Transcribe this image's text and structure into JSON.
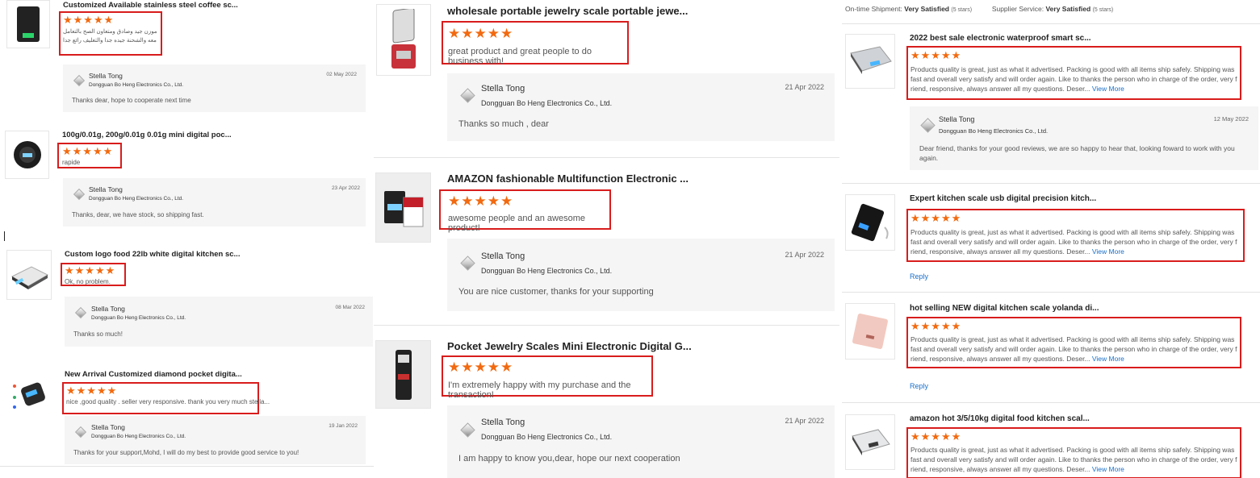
{
  "col1": {
    "reviews": [
      {
        "title": "Customized Available stainless steel coffee sc...",
        "stars": "★★★★★",
        "text": "موزن جيد وصادق ومتعاون الصح بالتعامل معه والشحنة جيده جدا والتغليف رائع جدا",
        "reply_name": "Stella Tong",
        "reply_company": "Dongguan Bo Heng Electronics Co., Ltd.",
        "reply_date": "02 May 2022",
        "reply_text": "Thanks dear, hope to cooperate next time"
      },
      {
        "title": "100g/0.01g, 200g/0.01g 0.01g mini digital poc...",
        "stars": "★★★★★",
        "text": "rapide",
        "reply_name": "Stella Tong",
        "reply_company": "Dongguan Bo Heng Electronics Co., Ltd.",
        "reply_date": "23 Apr 2022",
        "reply_text": "Thanks, dear, we have stock, so shipping fast."
      },
      {
        "title": "Custom logo food 22lb white digital kitchen sc...",
        "stars": "★★★★★",
        "text": "Ok, no problem.",
        "reply_name": "Stella Tong",
        "reply_company": "Dongguan Bo Heng Electronics Co., Ltd.",
        "reply_date": "08 Mar 2022",
        "reply_text": "Thanks so much!"
      },
      {
        "title": "New Arrival Customized diamond pocket digita...",
        "stars": "★★★★★",
        "text": "nice ,good quality . seller very responsive. thank you very much stella...",
        "reply_name": "Stella Tong",
        "reply_company": "Dongguan Bo Heng Electronics Co., Ltd.",
        "reply_date": "19 Jan 2022",
        "reply_text": "Thanks for your support,Mohd, I will do my best to provide good service to you!"
      }
    ]
  },
  "col2": {
    "reviews": [
      {
        "title": "wholesale portable jewelry scale portable jewe...",
        "stars": "★★★★★",
        "text": "great product and great people to do business with!",
        "reply_name": "Stella Tong",
        "reply_company": "Dongguan Bo Heng Electronics Co., Ltd.",
        "reply_date": "21 Apr 2022",
        "reply_text": "Thanks so much , dear"
      },
      {
        "title": "AMAZON fashionable Multifunction Electronic ...",
        "stars": "★★★★★",
        "text": "awesome people and an awesome product!",
        "reply_name": "Stella Tong",
        "reply_company": "Dongguan Bo Heng Electronics Co., Ltd.",
        "reply_date": "21 Apr 2022",
        "reply_text": "You are nice customer, thanks for your supporting"
      },
      {
        "title": "Pocket Jewelry Scales Mini Electronic Digital G...",
        "stars": "★★★★★",
        "text": "I'm extremely happy with my purchase and the transaction!",
        "reply_name": "Stella Tong",
        "reply_company": "Dongguan Bo Heng Electronics Co., Ltd.",
        "reply_date": "21 Apr 2022",
        "reply_text": "I am happy to know you,dear, hope our next cooperation"
      }
    ]
  },
  "col3": {
    "summary": {
      "shipment_label": "On-time Shipment:",
      "shipment_value": "Very Satisfied",
      "shipment_stars": "(5 stars)",
      "service_label": "Supplier Service:",
      "service_value": "Very Satisfied",
      "service_stars": "(5 stars)"
    },
    "reviews": [
      {
        "title": "2022 best sale electronic waterproof smart sc...",
        "stars": "★★★★★",
        "text": "Products quality is great, just as what it advertised. Packing is good with all items ship safely. Shipping was fast and overall very satisfy and will order again. Like to thanks the person who in charge of the order, very f riend, responsive, always answer all my questions. Deser...",
        "view_more": "View More",
        "reply_name": "Stella Tong",
        "reply_company": "Dongguan Bo Heng Electronics Co., Ltd.",
        "reply_date": "12 May 2022",
        "reply_text": "Dear friend, thanks for your good reviews, we are so happy to hear that, looking foward to work with you again."
      },
      {
        "title": "Expert kitchen scale usb digital precision kitch...",
        "stars": "★★★★★",
        "text": "Products quality is great, just as what it advertised. Packing is good with all items ship safely. Shipping was fast and overall very satisfy and will order again. Like to thanks the person who in charge of the order, very f riend, responsive, always answer all my questions. Deser...",
        "view_more": "View More",
        "reply_link": "Reply"
      },
      {
        "title": "hot selling NEW digital kitchen scale yolanda di...",
        "stars": "★★★★★",
        "text": "Products quality is great, just as what it advertised. Packing is good with all items ship safely. Shipping was fast and overall very satisfy and will order again. Like to thanks the person who in charge of the order, very f riend, responsive, always answer all my questions. Deser...",
        "view_more": "View More",
        "reply_link": "Reply"
      },
      {
        "title": "amazon hot 3/5/10kg digital food kitchen scal...",
        "stars": "★★★★★",
        "text": "Products quality is great, just as what it advertised. Packing is good with all items ship safely. Shipping was fast and overall very satisfy and will order again. Like to thanks the person who in charge of the order, very f riend, responsive, always answer all my questions. Deser...",
        "view_more": "View More"
      }
    ]
  },
  "colors": {
    "star": "#f26a10",
    "highlight_box": "#d91c1c",
    "link": "#1a6fc9",
    "reply_bg": "#f5f5f5"
  },
  "icons": {
    "product_thumb": "product-image",
    "reply_logo": "company-logo-icon",
    "star": "star-icon"
  }
}
